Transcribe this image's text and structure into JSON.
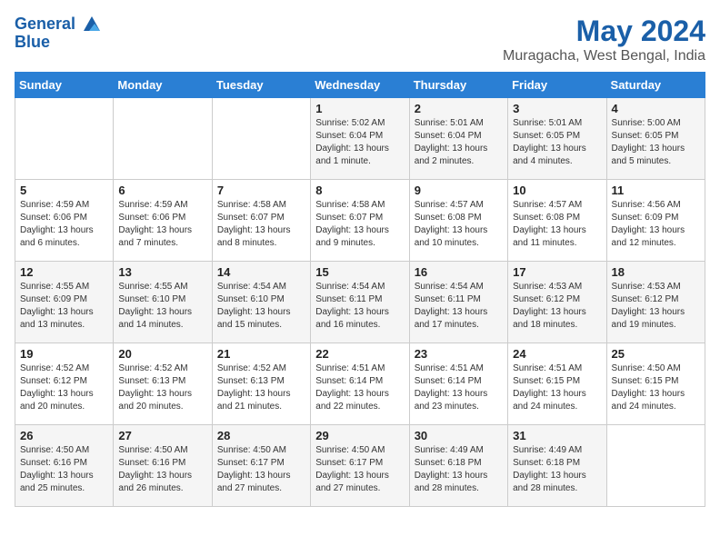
{
  "logo": {
    "line1": "General",
    "line2": "Blue"
  },
  "title": "May 2024",
  "subtitle": "Muragacha, West Bengal, India",
  "weekdays": [
    "Sunday",
    "Monday",
    "Tuesday",
    "Wednesday",
    "Thursday",
    "Friday",
    "Saturday"
  ],
  "weeks": [
    [
      {
        "num": "",
        "info": ""
      },
      {
        "num": "",
        "info": ""
      },
      {
        "num": "",
        "info": ""
      },
      {
        "num": "1",
        "info": "Sunrise: 5:02 AM\nSunset: 6:04 PM\nDaylight: 13 hours\nand 1 minute."
      },
      {
        "num": "2",
        "info": "Sunrise: 5:01 AM\nSunset: 6:04 PM\nDaylight: 13 hours\nand 2 minutes."
      },
      {
        "num": "3",
        "info": "Sunrise: 5:01 AM\nSunset: 6:05 PM\nDaylight: 13 hours\nand 4 minutes."
      },
      {
        "num": "4",
        "info": "Sunrise: 5:00 AM\nSunset: 6:05 PM\nDaylight: 13 hours\nand 5 minutes."
      }
    ],
    [
      {
        "num": "5",
        "info": "Sunrise: 4:59 AM\nSunset: 6:06 PM\nDaylight: 13 hours\nand 6 minutes."
      },
      {
        "num": "6",
        "info": "Sunrise: 4:59 AM\nSunset: 6:06 PM\nDaylight: 13 hours\nand 7 minutes."
      },
      {
        "num": "7",
        "info": "Sunrise: 4:58 AM\nSunset: 6:07 PM\nDaylight: 13 hours\nand 8 minutes."
      },
      {
        "num": "8",
        "info": "Sunrise: 4:58 AM\nSunset: 6:07 PM\nDaylight: 13 hours\nand 9 minutes."
      },
      {
        "num": "9",
        "info": "Sunrise: 4:57 AM\nSunset: 6:08 PM\nDaylight: 13 hours\nand 10 minutes."
      },
      {
        "num": "10",
        "info": "Sunrise: 4:57 AM\nSunset: 6:08 PM\nDaylight: 13 hours\nand 11 minutes."
      },
      {
        "num": "11",
        "info": "Sunrise: 4:56 AM\nSunset: 6:09 PM\nDaylight: 13 hours\nand 12 minutes."
      }
    ],
    [
      {
        "num": "12",
        "info": "Sunrise: 4:55 AM\nSunset: 6:09 PM\nDaylight: 13 hours\nand 13 minutes."
      },
      {
        "num": "13",
        "info": "Sunrise: 4:55 AM\nSunset: 6:10 PM\nDaylight: 13 hours\nand 14 minutes."
      },
      {
        "num": "14",
        "info": "Sunrise: 4:54 AM\nSunset: 6:10 PM\nDaylight: 13 hours\nand 15 minutes."
      },
      {
        "num": "15",
        "info": "Sunrise: 4:54 AM\nSunset: 6:11 PM\nDaylight: 13 hours\nand 16 minutes."
      },
      {
        "num": "16",
        "info": "Sunrise: 4:54 AM\nSunset: 6:11 PM\nDaylight: 13 hours\nand 17 minutes."
      },
      {
        "num": "17",
        "info": "Sunrise: 4:53 AM\nSunset: 6:12 PM\nDaylight: 13 hours\nand 18 minutes."
      },
      {
        "num": "18",
        "info": "Sunrise: 4:53 AM\nSunset: 6:12 PM\nDaylight: 13 hours\nand 19 minutes."
      }
    ],
    [
      {
        "num": "19",
        "info": "Sunrise: 4:52 AM\nSunset: 6:12 PM\nDaylight: 13 hours\nand 20 minutes."
      },
      {
        "num": "20",
        "info": "Sunrise: 4:52 AM\nSunset: 6:13 PM\nDaylight: 13 hours\nand 20 minutes."
      },
      {
        "num": "21",
        "info": "Sunrise: 4:52 AM\nSunset: 6:13 PM\nDaylight: 13 hours\nand 21 minutes."
      },
      {
        "num": "22",
        "info": "Sunrise: 4:51 AM\nSunset: 6:14 PM\nDaylight: 13 hours\nand 22 minutes."
      },
      {
        "num": "23",
        "info": "Sunrise: 4:51 AM\nSunset: 6:14 PM\nDaylight: 13 hours\nand 23 minutes."
      },
      {
        "num": "24",
        "info": "Sunrise: 4:51 AM\nSunset: 6:15 PM\nDaylight: 13 hours\nand 24 minutes."
      },
      {
        "num": "25",
        "info": "Sunrise: 4:50 AM\nSunset: 6:15 PM\nDaylight: 13 hours\nand 24 minutes."
      }
    ],
    [
      {
        "num": "26",
        "info": "Sunrise: 4:50 AM\nSunset: 6:16 PM\nDaylight: 13 hours\nand 25 minutes."
      },
      {
        "num": "27",
        "info": "Sunrise: 4:50 AM\nSunset: 6:16 PM\nDaylight: 13 hours\nand 26 minutes."
      },
      {
        "num": "28",
        "info": "Sunrise: 4:50 AM\nSunset: 6:17 PM\nDaylight: 13 hours\nand 27 minutes."
      },
      {
        "num": "29",
        "info": "Sunrise: 4:50 AM\nSunset: 6:17 PM\nDaylight: 13 hours\nand 27 minutes."
      },
      {
        "num": "30",
        "info": "Sunrise: 4:49 AM\nSunset: 6:18 PM\nDaylight: 13 hours\nand 28 minutes."
      },
      {
        "num": "31",
        "info": "Sunrise: 4:49 AM\nSunset: 6:18 PM\nDaylight: 13 hours\nand 28 minutes."
      },
      {
        "num": "",
        "info": ""
      }
    ]
  ]
}
